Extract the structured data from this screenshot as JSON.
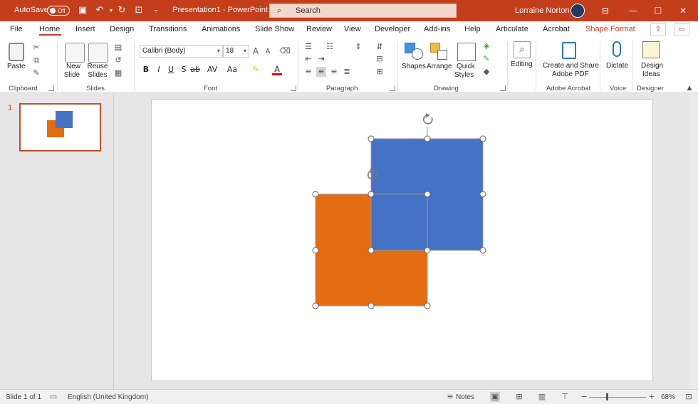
{
  "titlebar": {
    "autosave_label": "AutoSave",
    "autosave_state": "Off",
    "doc_title": "Presentation1  -  PowerPoint",
    "search_placeholder": "Search",
    "user_name": "Lorraine Norton"
  },
  "tabs": [
    "File",
    "Home",
    "Insert",
    "Design",
    "Transitions",
    "Animations",
    "Slide Show",
    "Review",
    "View",
    "Developer",
    "Add-ins",
    "Help",
    "Articulate",
    "Acrobat",
    "Shape Format"
  ],
  "active_tab": "Home",
  "ribbon": {
    "clipboard": {
      "paste": "Paste",
      "label": "Clipboard"
    },
    "slides": {
      "new_slide_1": "New",
      "new_slide_2": "Slide",
      "reuse_1": "Reuse",
      "reuse_2": "Slides",
      "label": "Slides"
    },
    "font": {
      "font_name": "Calibri (Body)",
      "font_size": "18",
      "label": "Font",
      "bold": "B",
      "italic": "I",
      "underline": "U",
      "strike": "S",
      "spacing": "AV",
      "case": "Aa",
      "grow": "A",
      "shrink": "A"
    },
    "paragraph": {
      "label": "Paragraph"
    },
    "drawing": {
      "shapes": "Shapes",
      "arrange": "Arrange",
      "quick_1": "Quick",
      "quick_2": "Styles",
      "label": "Drawing"
    },
    "editing": {
      "label": "Editing"
    },
    "acrobat": {
      "create_1": "Create and Share",
      "create_2": "Adobe PDF",
      "label": "Adobe Acrobat"
    },
    "voice": {
      "dictate": "Dictate",
      "label": "Voice"
    },
    "designer": {
      "design_1": "Design",
      "design_2": "Ideas",
      "label": "Designer"
    }
  },
  "thumbnail": {
    "number": "1"
  },
  "statusbar": {
    "slide_info": "Slide 1 of 1",
    "language": "English (United Kingdom)",
    "notes": "Notes",
    "zoom": "68%"
  },
  "colors": {
    "accent": "#c43e1c",
    "blue_shape": "#4472c4",
    "orange_shape": "#e46c12"
  }
}
